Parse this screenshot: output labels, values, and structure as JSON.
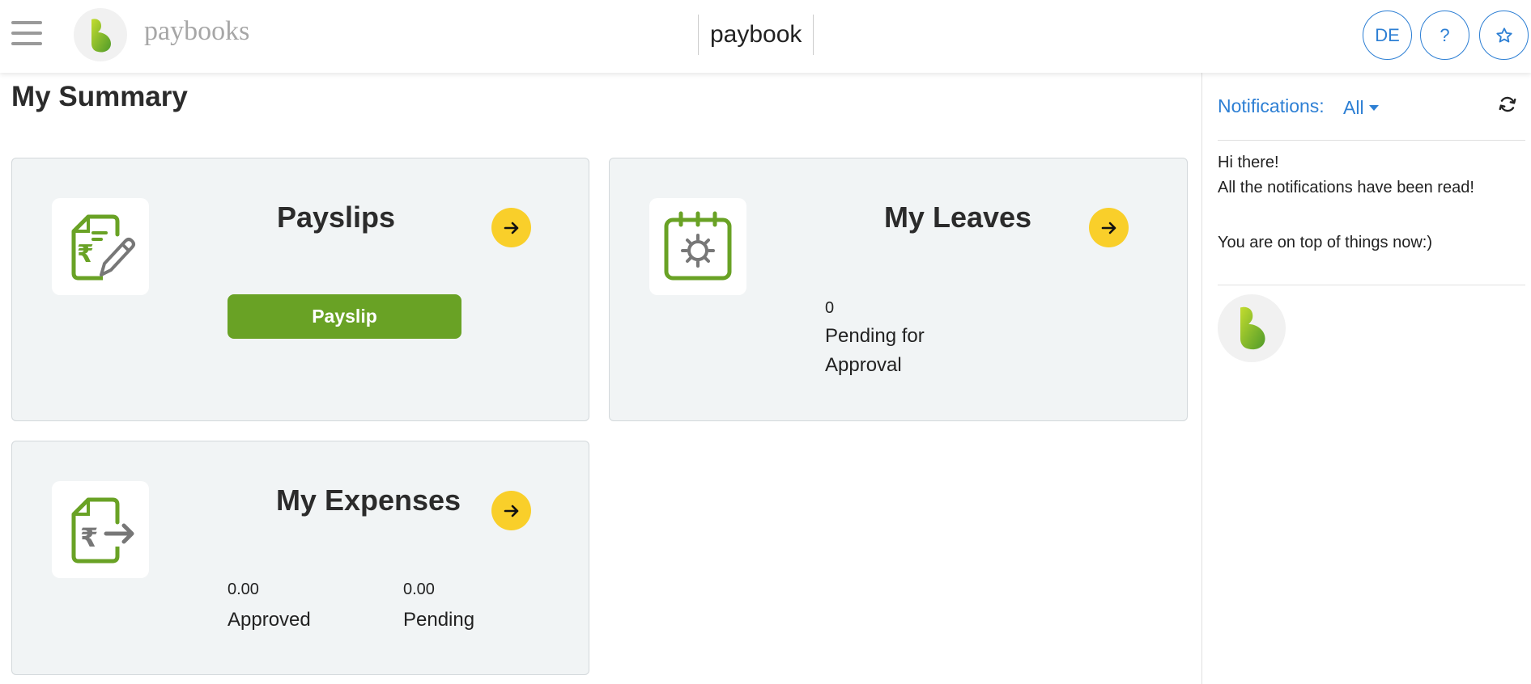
{
  "header": {
    "brand": "paybooks",
    "company": "paybook",
    "lang_button": "DE",
    "help_button": "?",
    "icons": {
      "menu": "hamburger-menu-icon",
      "logo": "paybooks-logo-icon",
      "star": "star-icon"
    }
  },
  "main": {
    "title": "My Summary",
    "cards": {
      "payslips": {
        "title": "Payslips",
        "button": "Payslip",
        "icon": "payslip-edit-icon"
      },
      "leaves": {
        "title": "My Leaves",
        "pending_value": "0",
        "pending_label": "Pending for Approval",
        "icon": "calendar-sun-icon"
      },
      "expenses": {
        "title": "My Expenses",
        "approved_value": "0.00",
        "approved_label": "Approved",
        "pending_value": "0.00",
        "pending_label": "Pending",
        "icon": "expense-transfer-icon"
      }
    }
  },
  "notifications": {
    "label": "Notifications:",
    "filter": "All",
    "greeting": "Hi there!",
    "message": "All the notifications have been read!",
    "footer": "You are on top of things now:)",
    "icons": {
      "refresh": "refresh-icon"
    }
  },
  "colors": {
    "accent_blue": "#2d7fd4",
    "brand_green": "#69a225",
    "arrow_yellow": "#f9cf2a",
    "card_bg": "#f1f4f5"
  }
}
